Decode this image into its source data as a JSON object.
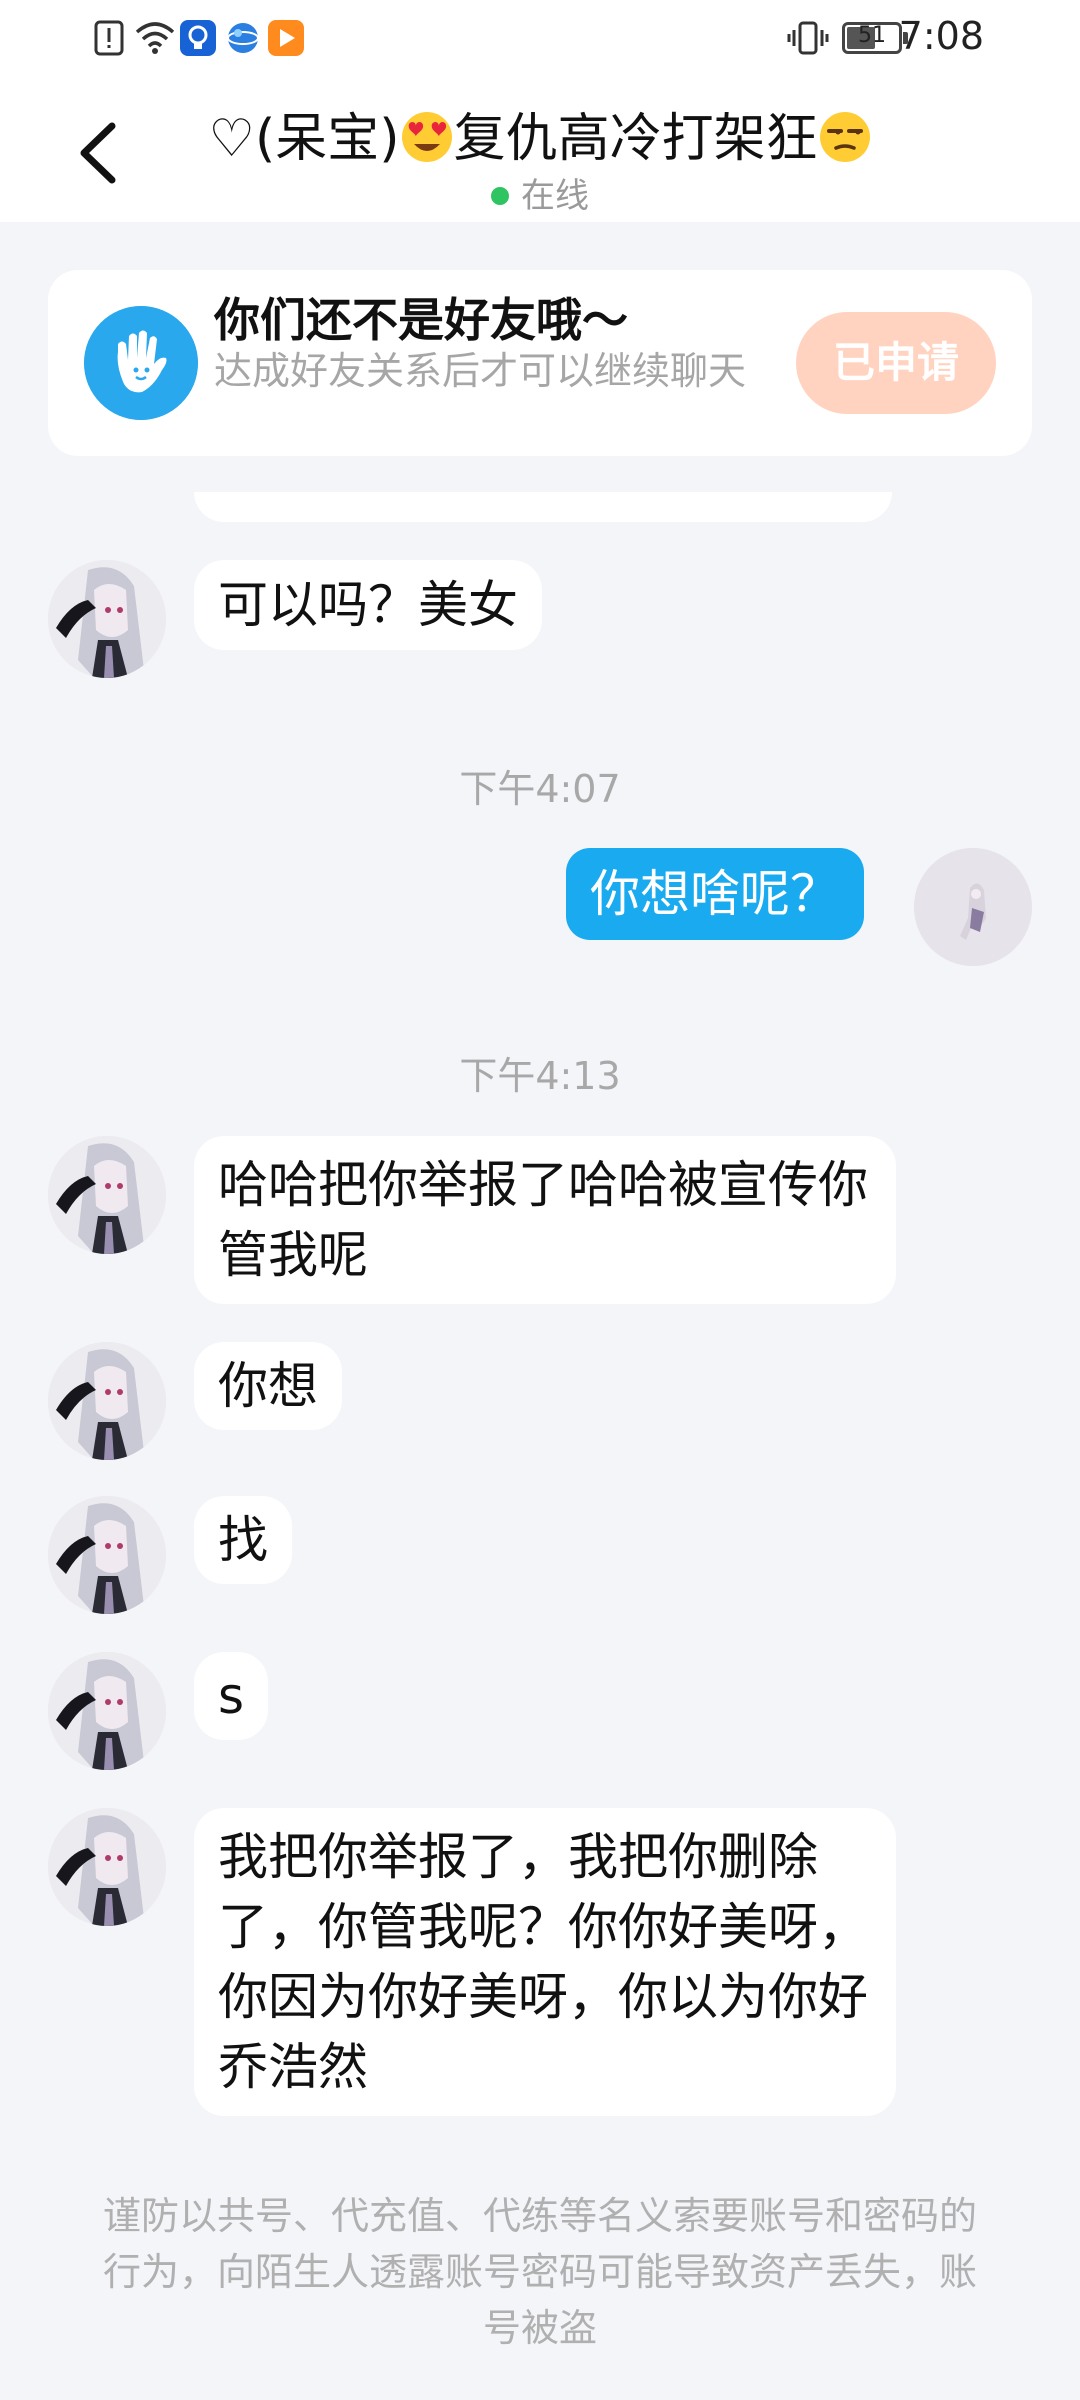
{
  "status_bar": {
    "time": "7:08",
    "battery": "51",
    "icons": [
      "alert-icon",
      "wifi-icon",
      "bulb-app-icon",
      "browser-app-icon",
      "video-app-icon",
      "vibrate-icon",
      "battery-icon"
    ]
  },
  "header": {
    "title_prefix": "♡(呆宝)",
    "title_suffix": "复仇高冷打架狂",
    "status": "在线",
    "online_color": "#2ec461"
  },
  "friend_card": {
    "title": "你们还不是好友哦～",
    "subtitle": "达成好友关系后才可以继续聊天",
    "button": "已申请",
    "button_color": "#ffd3c0"
  },
  "messages": [
    {
      "side": "left",
      "text": "可以吗？美女"
    },
    {
      "type": "time",
      "text": "下午4:07"
    },
    {
      "side": "right",
      "text": "你想啥呢？"
    },
    {
      "type": "time",
      "text": "下午4:13"
    },
    {
      "side": "left",
      "text": "哈哈把你举报了哈哈被宣传你管我呢"
    },
    {
      "side": "left",
      "text": "你想"
    },
    {
      "side": "left",
      "text": "找"
    },
    {
      "side": "left",
      "text": "s"
    },
    {
      "side": "left",
      "text": "我把你举报了，我把你删除了，你管我呢？你你好美呀，你因为你好美呀，你以为你好乔浩然"
    }
  ],
  "notice": "谨防以共号、代充值、代练等名义索要账号和密码的行为，向陌生人透露账号密码可能导致资产丢失，账号被盗",
  "colors": {
    "sent_bubble": "#1aaaf0",
    "background": "#f3f5f9"
  }
}
